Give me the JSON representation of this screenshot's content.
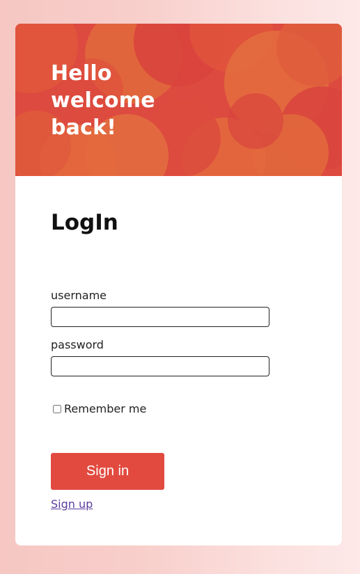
{
  "hero": {
    "title": "Hello\nwelcome\nback!"
  },
  "login": {
    "title": "LogIn"
  },
  "form": {
    "username_label": "username",
    "username_value": "",
    "password_label": "password",
    "password_value": "",
    "remember_label": "Remember me",
    "remember_checked": false,
    "signin_label": "Sign in",
    "signup_label": "Sign up"
  },
  "colors": {
    "hero_base": "#dd4a3f",
    "accent": "#e24a40",
    "link": "#5b3c9e"
  }
}
